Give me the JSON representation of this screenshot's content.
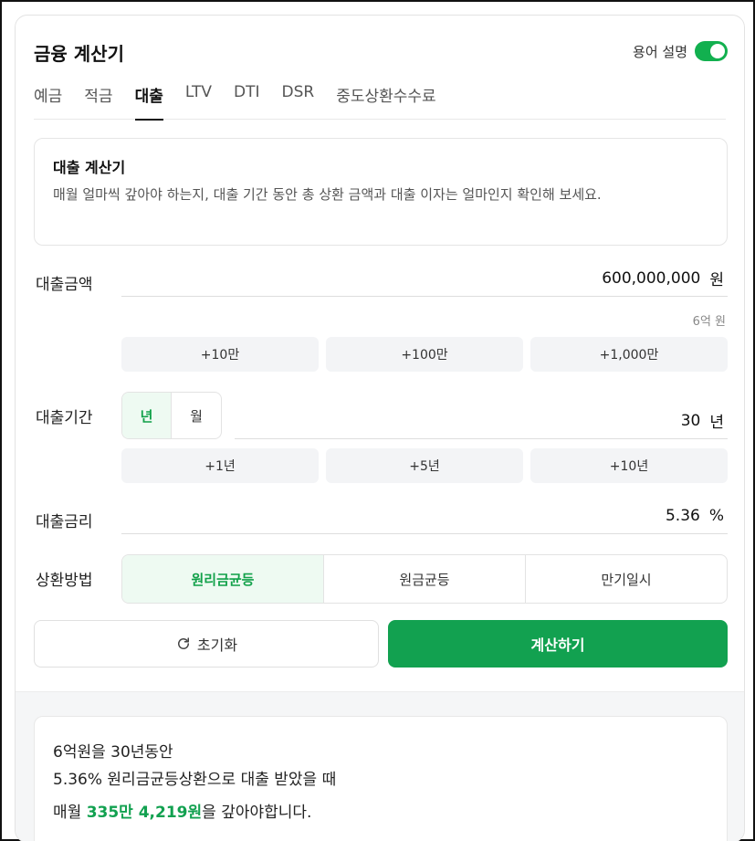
{
  "header": {
    "title": "금융 계산기",
    "term_toggle_label": "용어 설명",
    "term_toggle_on": true
  },
  "tabs": [
    {
      "label": "예금",
      "active": false
    },
    {
      "label": "적금",
      "active": false
    },
    {
      "label": "대출",
      "active": true
    },
    {
      "label": "LTV",
      "active": false
    },
    {
      "label": "DTI",
      "active": false
    },
    {
      "label": "DSR",
      "active": false
    },
    {
      "label": "중도상환수수료",
      "active": false
    }
  ],
  "info": {
    "title": "대출 계산기",
    "description": "매월 얼마씩 갚아야 하는지, 대출 기간 동안 총 상환 금액과 대출 이자는 얼마인지 확인해 보세요."
  },
  "loan_amount": {
    "label": "대출금액",
    "value": "600,000,000",
    "unit": "원",
    "hint": "6억 원",
    "chips": [
      "+10만",
      "+100만",
      "+1,000만"
    ]
  },
  "loan_period": {
    "label": "대출기간",
    "unit_options": [
      "년",
      "월"
    ],
    "selected_unit": "년",
    "value": "30",
    "unit": "년",
    "chips": [
      "+1년",
      "+5년",
      "+10년"
    ]
  },
  "interest_rate": {
    "label": "대출금리",
    "value": "5.36",
    "unit": "%"
  },
  "repayment": {
    "label": "상환방법",
    "options": [
      "원리금균등",
      "원금균등",
      "만기일시"
    ],
    "selected": "원리금균등"
  },
  "buttons": {
    "reset_label": "초기화",
    "calc_label": "계산하기"
  },
  "result": {
    "line1": "6억원을 30년동안",
    "line2": "5.36% 원리금균등상환으로 대출 받았을 때",
    "line3_prefix": "매월 ",
    "line3_amount": "335만 4,219원",
    "line3_suffix": "을 갚아야합니다."
  },
  "colors": {
    "accent": "#12a150",
    "toggle": "#12b04f",
    "chip_bg": "#f3f4f6",
    "selected_bg": "#eefaf2"
  }
}
